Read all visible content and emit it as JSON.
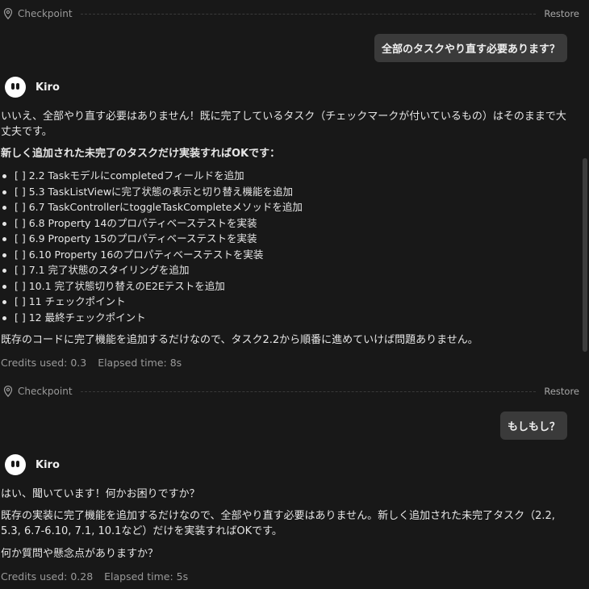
{
  "checkpoint1": {
    "label": "Checkpoint",
    "restore": "Restore"
  },
  "user1": {
    "text": "全部のタスクやり直す必要あります？"
  },
  "bot1": {
    "name": "Kiro",
    "p1": "いいえ、全部やり直す必要はありません！既に完了しているタスク（チェックマークが付いているもの）はそのままで大丈夫です。",
    "heading": "新しく追加された未完了のタスクだけ実装すればOKです：",
    "tasks": [
      "[ ] 2.2 Taskモデルにcompletedフィールドを追加",
      "[ ] 5.3 TaskListViewに完了状態の表示と切り替え機能を追加",
      "[ ] 6.7 TaskControllerにtoggleTaskCompleteメソッドを追加",
      "[ ] 6.8 Property 14のプロパティベーステストを実装",
      "[ ] 6.9 Property 15のプロパティベーステストを実装",
      "[ ] 6.10 Property 16のプロパティベーステストを実装",
      "[ ] 7.1 完了状態のスタイリングを追加",
      "[ ] 10.1 完了状態切り替えのE2Eテストを追加",
      "[ ] 11 チェックポイント",
      "[ ] 12 最終チェックポイント"
    ],
    "p2": "既存のコードに完了機能を追加するだけなので、タスク2.2から順番に進めていけば問題ありません。",
    "credits": "Credits used: 0.3",
    "elapsed": "Elapsed time: 8s"
  },
  "checkpoint2": {
    "label": "Checkpoint",
    "restore": "Restore"
  },
  "user2": {
    "text": "もしもし？"
  },
  "bot2": {
    "name": "Kiro",
    "p1": "はい、聞いています！何かお困りですか？",
    "p2": "既存の実装に完了機能を追加するだけなので、全部やり直す必要はありません。新しく追加された未完了タスク（2.2, 5.3, 6.7-6.10, 7.1, 10.1など）だけを実装すればOKです。",
    "p3": "何か質問や懸念点がありますか？",
    "credits": "Credits used: 0.28",
    "elapsed": "Elapsed time: 5s"
  }
}
